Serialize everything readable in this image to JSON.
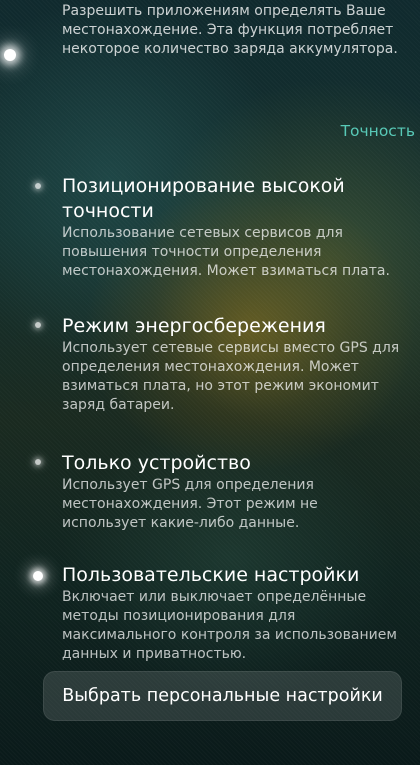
{
  "intro_text": "Разрешить приложениям определять Ваше местонахождение. Эта функция потребляет некоторое количество заряда аккумулятора.",
  "section_link": "Точность",
  "options": [
    {
      "title": "Позиционирование высокой точности",
      "description": "Использование сетевых сервисов для повышения точности определения местонахождения. Может взиматься плата.",
      "selected": false
    },
    {
      "title": "Режим энергосбережения",
      "description": "Использует сетевые сервисы вместо GPS для определения местонахождения. Может взиматься плата, но этот режим экономит заряд батареи.",
      "selected": false
    },
    {
      "title": "Только устройство",
      "description": "Использует GPS для определения местонахождения. Этот режим не использует какие-либо данные.",
      "selected": false
    },
    {
      "title": "Пользовательские настройки",
      "description": "Включает или выключает определённые методы позиционирования для максимального контроля за использованием данных и приватностью.",
      "selected": true
    }
  ],
  "personal_button_label": "Выбрать персональные настройки",
  "colors": {
    "accent": "#58c9b7",
    "text_primary": "#ffffff"
  }
}
